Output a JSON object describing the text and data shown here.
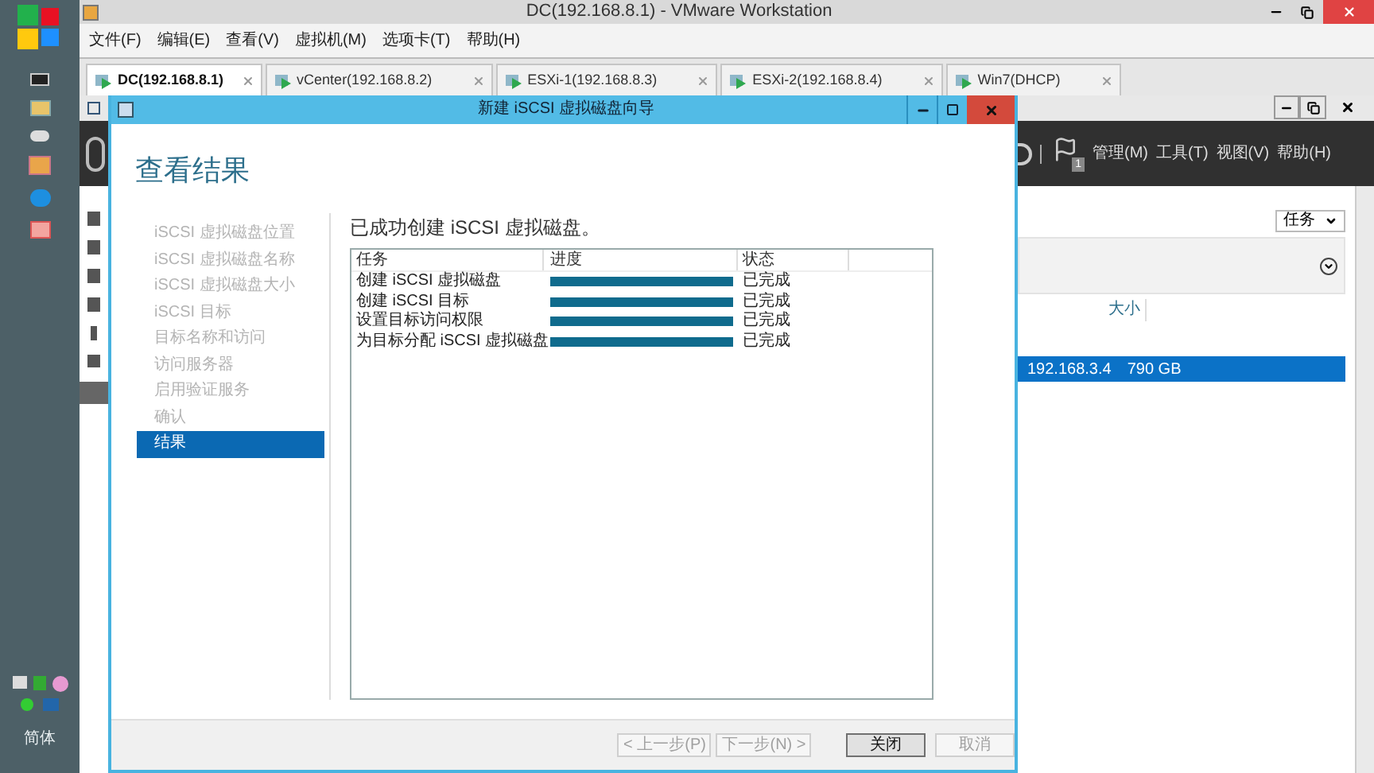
{
  "taskbar": {
    "language": "简体"
  },
  "window": {
    "title": "DC(192.168.8.1) - VMware Workstation"
  },
  "menu": [
    "文件(F)",
    "编辑(E)",
    "查看(V)",
    "虚拟机(M)",
    "选项卡(T)",
    "帮助(H)"
  ],
  "tabs": [
    {
      "label": "DC(192.168.8.1)",
      "selected": true
    },
    {
      "label": "vCenter(192.168.8.2)",
      "selected": false
    },
    {
      "label": "ESXi-1(192.168.8.3)",
      "selected": false
    },
    {
      "label": "ESXi-2(192.168.8.4)",
      "selected": false
    },
    {
      "label": "Win7(DHCP)",
      "selected": false
    }
  ],
  "dialog": {
    "title": "新建 iSCSI 虚拟磁盘向导",
    "heading": "查看结果",
    "steps": [
      {
        "label": "iSCSI 虚拟磁盘位置",
        "selected": false
      },
      {
        "label": "iSCSI 虚拟磁盘名称",
        "selected": false
      },
      {
        "label": "iSCSI 虚拟磁盘大小",
        "selected": false
      },
      {
        "label": "iSCSI 目标",
        "selected": false
      },
      {
        "label": "目标名称和访问",
        "selected": false
      },
      {
        "label": "访问服务器",
        "selected": false
      },
      {
        "label": "启用验证服务",
        "selected": false
      },
      {
        "label": "确认",
        "selected": false
      },
      {
        "label": "结果",
        "selected": true
      }
    ],
    "message": "已成功创建 iSCSI 虚拟磁盘。",
    "table": {
      "columns": [
        "任务",
        "进度",
        "状态"
      ],
      "rows": [
        {
          "task": "创建 iSCSI 虚拟磁盘",
          "level": 1,
          "status": "已完成"
        },
        {
          "task": "创建 iSCSI 目标",
          "level": 1,
          "status": "已完成"
        },
        {
          "task": "设置目标访问权限",
          "level": 1,
          "status": "已完成"
        },
        {
          "task": "为目标分配 iSCSI 虚拟磁盘",
          "level": 1,
          "status": "已完成"
        }
      ]
    },
    "buttons": [
      {
        "label": "< 上一步(P)",
        "disabled": true,
        "default": false
      },
      {
        "label": "下一步(N) >",
        "disabled": true,
        "default": false
      },
      {
        "label": "关闭",
        "disabled": false,
        "default": true
      },
      {
        "label": "取消",
        "disabled": true,
        "default": false
      }
    ]
  },
  "server_manager": {
    "notification_count": "1",
    "menu": [
      "管理(M)",
      "工具(T)",
      "视图(V)",
      "帮助(H)"
    ],
    "tasks_button": "任务",
    "columns": [
      "大小"
    ],
    "rows": [
      {
        "column_1": "192.168.3.4",
        "size": "790 GB",
        "selected": true
      }
    ]
  }
}
